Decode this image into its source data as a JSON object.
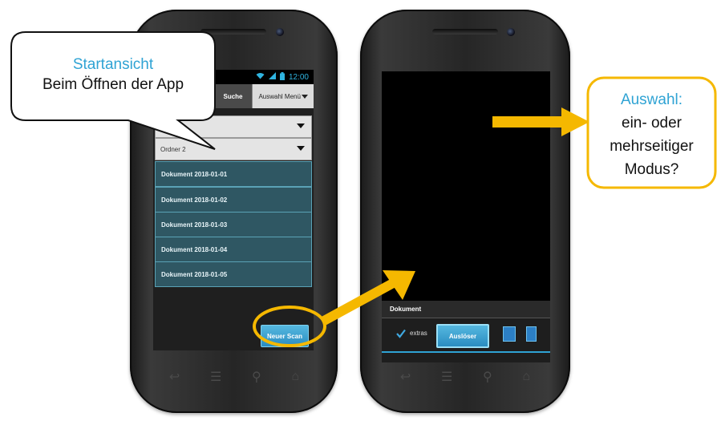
{
  "left_phone": {
    "status_time": "12:00",
    "tabs": {
      "search_label": "Suche",
      "menu_label": "Auswahl Menü"
    },
    "folders": [
      {
        "label": ""
      },
      {
        "label": "Ordner 2"
      }
    ],
    "documents": [
      {
        "label": "Dokument 2018-01-01"
      },
      {
        "label": "Dokument 2018-01-02"
      },
      {
        "label": "Dokument 2018-01-03"
      },
      {
        "label": "Dokument 2018-01-04"
      },
      {
        "label": "Dokument 2018-01-05"
      }
    ],
    "new_scan_label": "Neuer Scan"
  },
  "right_phone": {
    "panel_title": "Dokument",
    "extras_label": "extras",
    "shutter_label": "Auslöser"
  },
  "callout_left": {
    "title": "Startansicht",
    "text": "Beim Öffnen der App"
  },
  "callout_right": {
    "title": "Auswahl:",
    "lines": [
      "ein- oder",
      "mehrseitiger",
      "Modus?"
    ]
  },
  "colors": {
    "accent_blue": "#2fa3d4",
    "highlight_yellow": "#f5b800",
    "list_teal": "#2f5763"
  },
  "icons": [
    "wifi-icon",
    "signal-icon",
    "battery-icon",
    "back-icon",
    "menu-icon",
    "search-icon",
    "home-icon",
    "checkmark-icon",
    "single-page-icon",
    "multi-page-icon"
  ]
}
